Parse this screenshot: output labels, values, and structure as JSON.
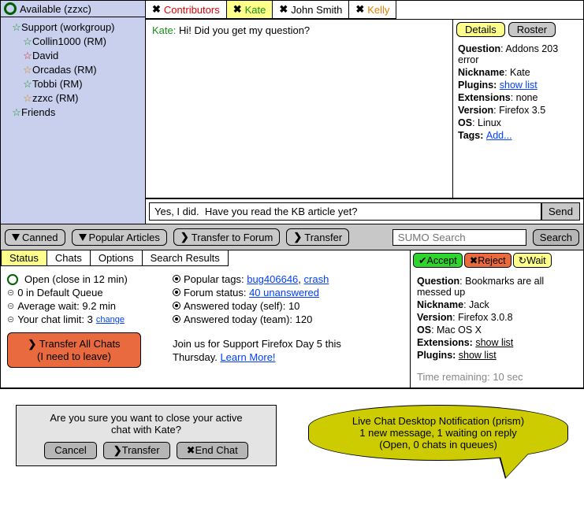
{
  "status": {
    "text": "Available (zzxc)"
  },
  "tree": {
    "support_group": "Support (workgroup)",
    "members": [
      {
        "name": "Collin1000 (RM)",
        "star": "green"
      },
      {
        "name": "David",
        "star": "red"
      },
      {
        "name": "Orcadas (RM)",
        "star": "orange"
      },
      {
        "name": "Tobbi (RM)",
        "star": "green"
      },
      {
        "name": "zzxc (RM)",
        "star": "orange"
      }
    ],
    "friends": "Friends"
  },
  "tabs": [
    {
      "label": "Contributors",
      "cls": "tab-red"
    },
    {
      "label": "Kate",
      "cls": "tab-green",
      "active": true
    },
    {
      "label": "John Smith",
      "cls": "tab-black"
    },
    {
      "label": "Kelly",
      "cls": "tab-orange"
    }
  ],
  "chat": {
    "speaker": "Kate:",
    "msg": " Hi!  Did you get my question?"
  },
  "detail_tabs": {
    "details": "Details",
    "roster": "Roster"
  },
  "details": {
    "question_lbl": "Question",
    "question_val": ": Addons 203 error",
    "nickname_lbl": "Nickname",
    "nickname_val": ": Kate",
    "plugins_lbl": "Plugins: ",
    "plugins_link": "show list",
    "ext_lbl": "Extensions",
    "ext_val": ": none",
    "version_lbl": "Version",
    "version_val": ": Firefox 3.5",
    "os_lbl": "OS",
    "os_val": ": Linux",
    "tags_lbl": "Tags: ",
    "tags_link": "Add..."
  },
  "input": {
    "value": "Yes, I did.  Have you read the KB article yet?",
    "send": "Send"
  },
  "toolbar": {
    "canned": "Canned",
    "popular": "Popular Articles",
    "tforum": "Transfer to Forum",
    "transfer": "Transfer",
    "search_ph": "SUMO Search",
    "search_btn": "Search"
  },
  "sec_tabs": {
    "status": "Status",
    "chats": "Chats",
    "options": "Options",
    "results": "Search Results"
  },
  "status_col": {
    "open": "Open (close in 12 min)",
    "queue": "0 in Default Queue",
    "wait": "Average wait: 9.2 min",
    "limit_pre": "Your chat limit: 3 ",
    "limit_link": "change",
    "transfer_all_1": "Transfer All Chats",
    "transfer_all_2": "(I need to leave)"
  },
  "info_col": {
    "tags_pre": "Popular tags: ",
    "tag1": "bug406646",
    "comma": ", ",
    "tag2": "crash",
    "forum_pre": "Forum status: ",
    "forum_link": "40 unanswered",
    "self": "Answered today (self): 10",
    "team": "Answered today (team): 120",
    "promo_1": "Join us for Support Firefox Day 5 this",
    "promo_2": "Thursday.  ",
    "promo_link": "Learn More!"
  },
  "actions": {
    "accept": "Accept",
    "reject": "Reject",
    "wait": "Wait"
  },
  "qdetails": {
    "q_lbl": "Question",
    "q_val": ": Bookmarks are all messed up",
    "nick_lbl": "Nickname",
    "nick_val": ": Jack",
    "ver_lbl": "Version",
    "ver_val": ": Firefox 3.0.8",
    "os_lbl": "OS",
    "os_val": ": Mac OS X",
    "ext_lbl": "Extensions: ",
    "ext_link": "show list",
    "plg_lbl": "Plugins: ",
    "plg_link": "show list",
    "time": "Time remaining: 10 sec"
  },
  "dialog": {
    "line1": "Are you sure you want to close your active",
    "line2": "chat with Kate?",
    "cancel": "Cancel",
    "transfer": "Transfer",
    "end": "End Chat"
  },
  "bubble": {
    "l1": "Live Chat Desktop Notification (prism)",
    "l2": "1 new message, 1 waiting on reply",
    "l3": "(Open, 0 chats in queues)"
  }
}
